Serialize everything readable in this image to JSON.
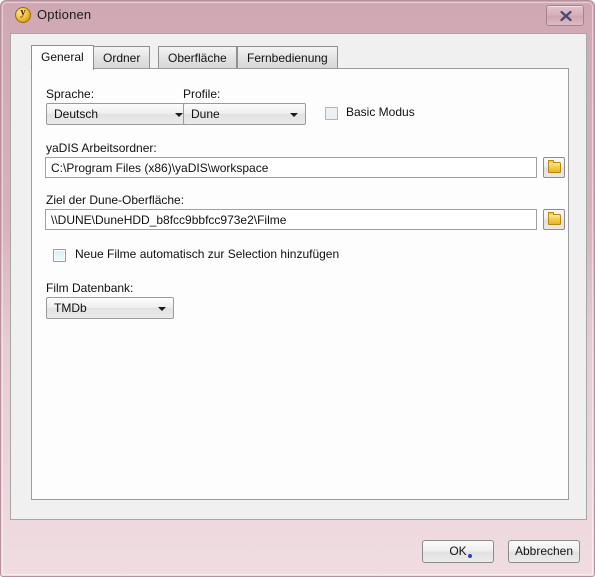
{
  "window": {
    "title": "Optionen",
    "icon": "yadis-coin-icon",
    "icon_glyph": "y",
    "close_label": "close-icon",
    "frame_color": "#d3abb6",
    "client_bg": "#f0f0f0"
  },
  "tabs": [
    {
      "label": "General",
      "active": true
    },
    {
      "label": "Ordner",
      "active": false
    },
    {
      "label": "Oberfläche",
      "active": false
    },
    {
      "label": "Fernbedienung",
      "active": false
    }
  ],
  "form": {
    "language": {
      "label": "Sprache:",
      "value": "Deutsch",
      "options": [
        "Deutsch"
      ]
    },
    "profile": {
      "label": "Profile:",
      "value": "Dune",
      "options": [
        "Dune"
      ]
    },
    "basic_mode": {
      "label": "Basic Modus",
      "checked": false,
      "enabled": false
    },
    "work_folder": {
      "label": "yaDIS Arbeitsordner:",
      "value": "C:\\Program Files (x86)\\yaDIS\\workspace",
      "browse_icon": "folder-icon"
    },
    "dune_target": {
      "label": "Ziel der Dune-Oberfläche:",
      "value": "\\\\DUNE\\DuneHDD_b8fcc9bbfcc973e2\\Filme",
      "browse_icon": "folder-icon"
    },
    "auto_add": {
      "label": "Neue Filme automatisch zur Selection hinzufügen",
      "checked": false,
      "focused": true
    },
    "movie_db": {
      "label": "Film Datenbank:",
      "value": "TMDb",
      "options": [
        "TMDb"
      ]
    }
  },
  "footer": {
    "ok_label": "OK",
    "cancel_label": "Abbrechen"
  },
  "colors": {
    "accent_cursor": "#2b3fcf",
    "focus_border": "#4fb8c9",
    "folder_yellow": "#f3cf55"
  }
}
